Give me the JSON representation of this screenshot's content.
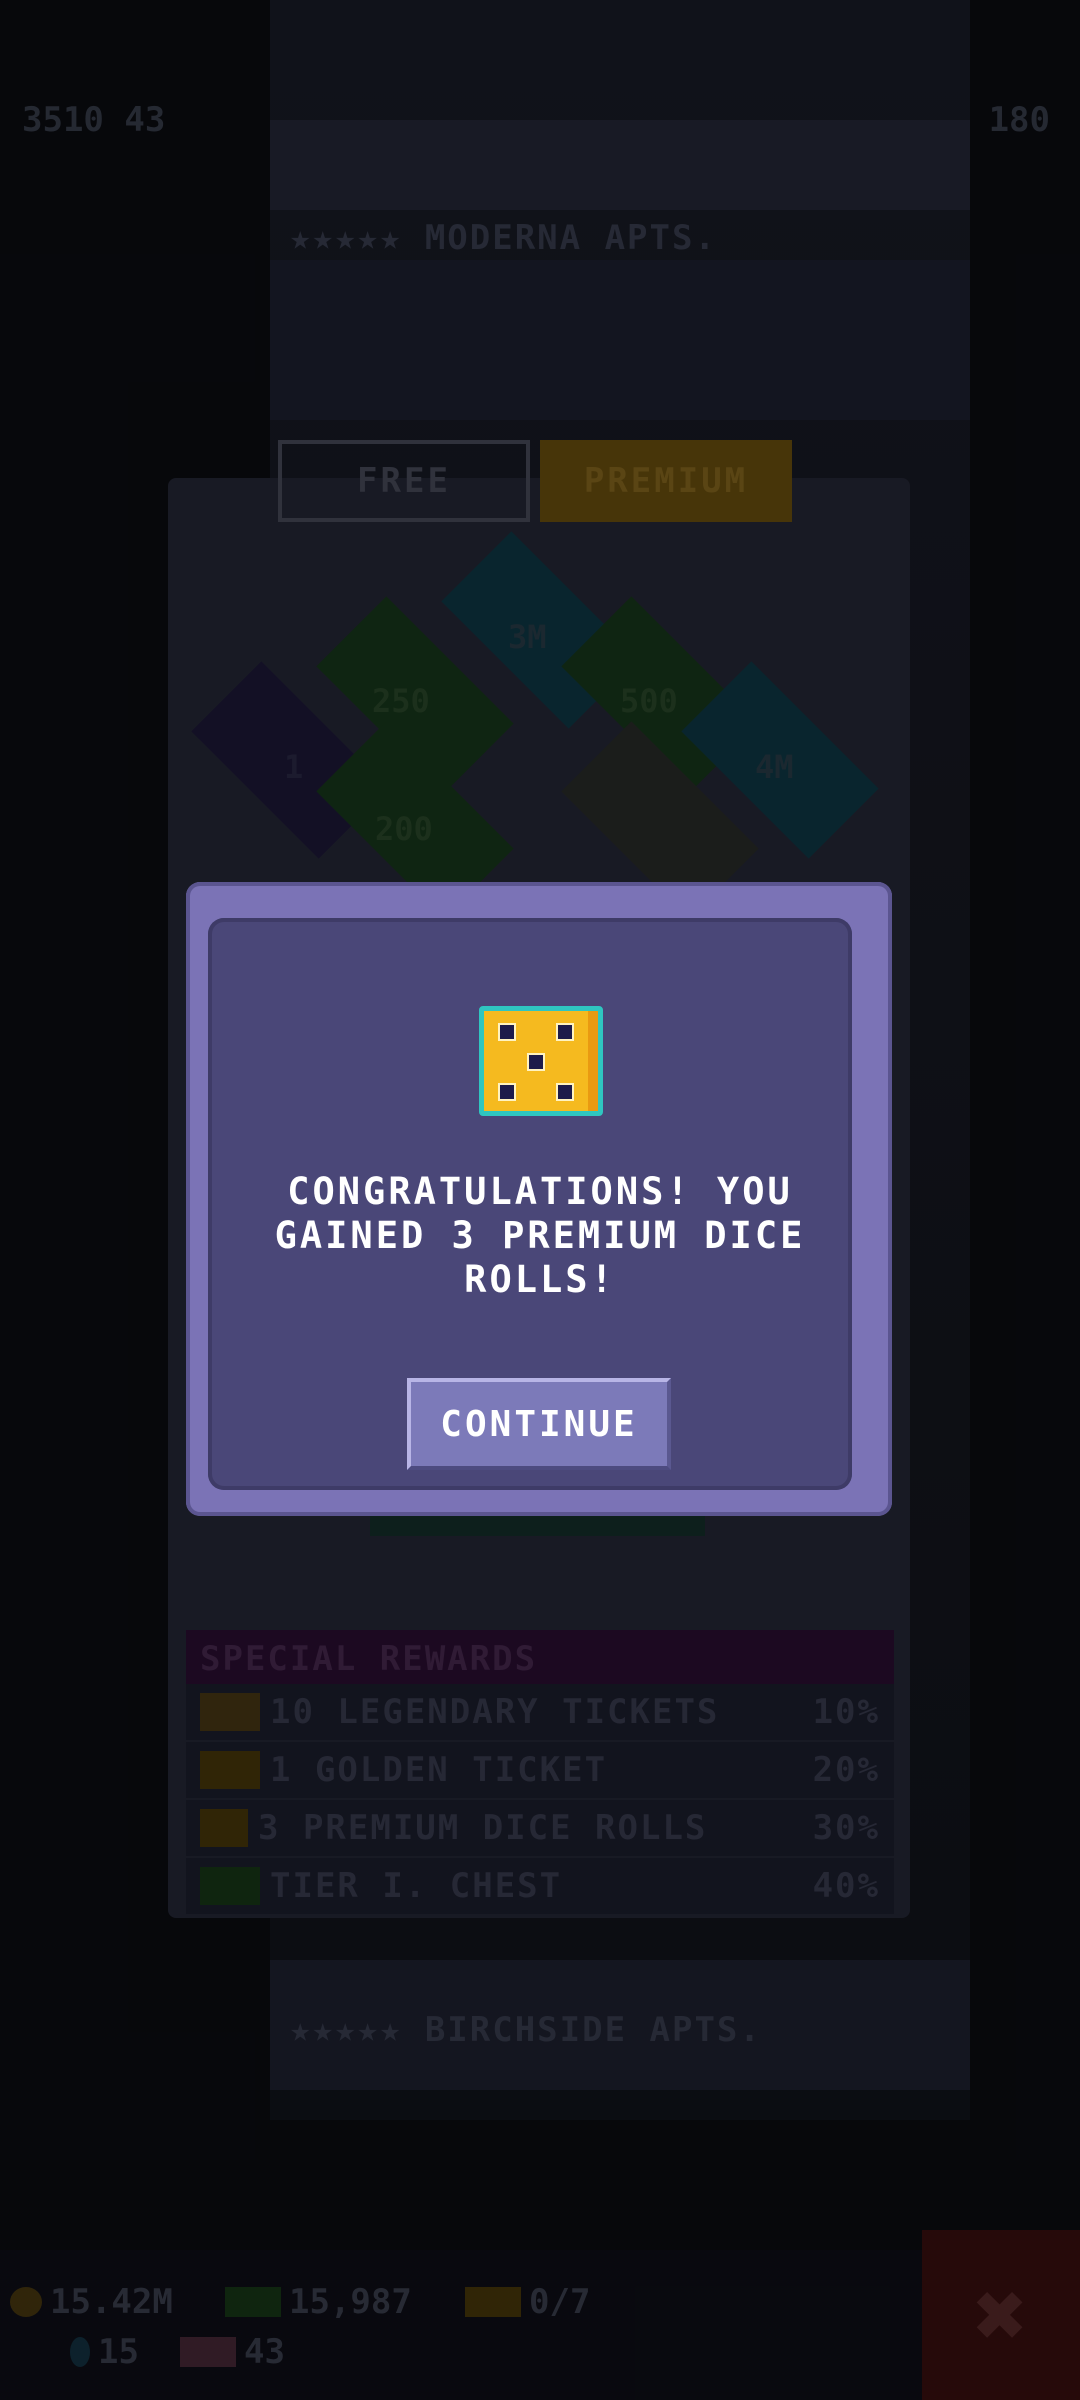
{
  "top_bar": {
    "left_stat": "3510 43",
    "right_stat": "180"
  },
  "building": {
    "top_floor_name": "★★★★★ MODERNA APTS.",
    "bottom_floor_name": "★★★★★ BIRCHSIDE APTS."
  },
  "tabs": {
    "free": "FREE",
    "premium": "PREMIUM"
  },
  "board_tiles": [
    {
      "label": "3M"
    },
    {
      "label": "250"
    },
    {
      "label": "500"
    },
    {
      "label": "1"
    },
    {
      "label": "4M"
    },
    {
      "label": "200"
    }
  ],
  "special_rewards": {
    "title": "SPECIAL REWARDS",
    "rows": [
      {
        "text": "10 LEGENDARY TICKETS",
        "pct": "10%",
        "icon": "legendary-ticket-icon"
      },
      {
        "text": "1 GOLDEN TICKET",
        "pct": "20%",
        "icon": "golden-ticket-icon"
      },
      {
        "text": "3 PREMIUM DICE ROLLS",
        "pct": "30%",
        "icon": "premium-dice-icon"
      },
      {
        "text": "TIER I. CHEST",
        "pct": "40%",
        "icon": "chest-icon"
      }
    ]
  },
  "bottom_stats": {
    "coins": "15.42M",
    "bux": "15,987",
    "tickets": "0/7",
    "gems": "15",
    "legendary": "43"
  },
  "modal": {
    "icon": "premium-dice-icon",
    "message": "CONGRATULATIONS! YOU GAINED 3 PREMIUM DICE ROLLS!",
    "button": "CONTINUE"
  },
  "colors": {
    "modal_outer": "#7b73b6",
    "modal_inner": "#4a4778",
    "dice_face": "#f5ba1f",
    "dice_border": "#2fc6c0",
    "premium_tab": "#7a5a10"
  }
}
